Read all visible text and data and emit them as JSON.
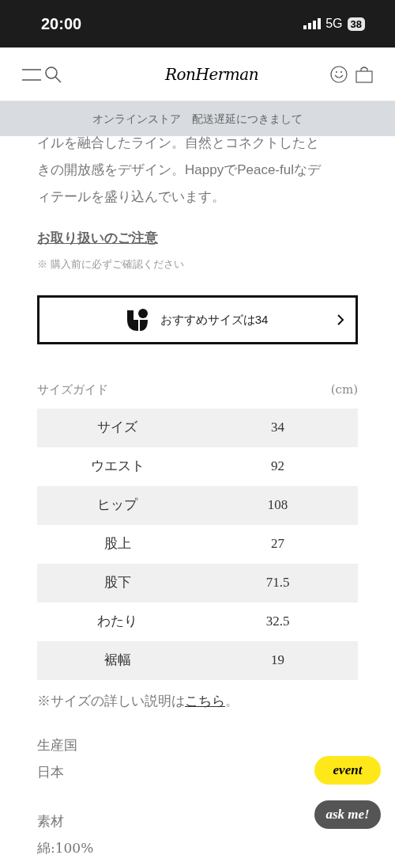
{
  "status_bar": {
    "time": "20:00",
    "network": "5G",
    "battery": "38"
  },
  "header": {
    "logo": "RonHerman"
  },
  "banner": {
    "text": "オンラインストア　配送遅延につきまして"
  },
  "description": {
    "lines": [
      "イルを融合したライン。自然とコネクトしたと",
      "きの開放感をデザイン。HappyでPeace-fulなデ",
      "ィテールを盛り込んでいます。"
    ]
  },
  "care": {
    "title": "お取り扱いのご注意",
    "note": "※ 購入前に必ずご確認ください"
  },
  "recommend_button": {
    "label": "おすすめサイズは34"
  },
  "size_guide": {
    "title": "サイズガイド",
    "unit": "(cm)",
    "rows": [
      {
        "label": "サイズ",
        "value": "34"
      },
      {
        "label": "ウエスト",
        "value": "92"
      },
      {
        "label": "ヒップ",
        "value": "108"
      },
      {
        "label": "股上",
        "value": "27"
      },
      {
        "label": "股下",
        "value": "71.5"
      },
      {
        "label": "わたり",
        "value": "32.5"
      },
      {
        "label": "裾幅",
        "value": "19"
      }
    ],
    "footnote": "※サイズの詳しい説明は",
    "link": "こちら",
    "footnote_end": "。"
  },
  "details": [
    {
      "label": "生産国",
      "value": "日本"
    },
    {
      "label": "素材",
      "value": "綿:100%"
    }
  ],
  "floating": [
    {
      "label": "event",
      "kind": "event"
    },
    {
      "label": "ask me!",
      "kind": "ask"
    }
  ]
}
